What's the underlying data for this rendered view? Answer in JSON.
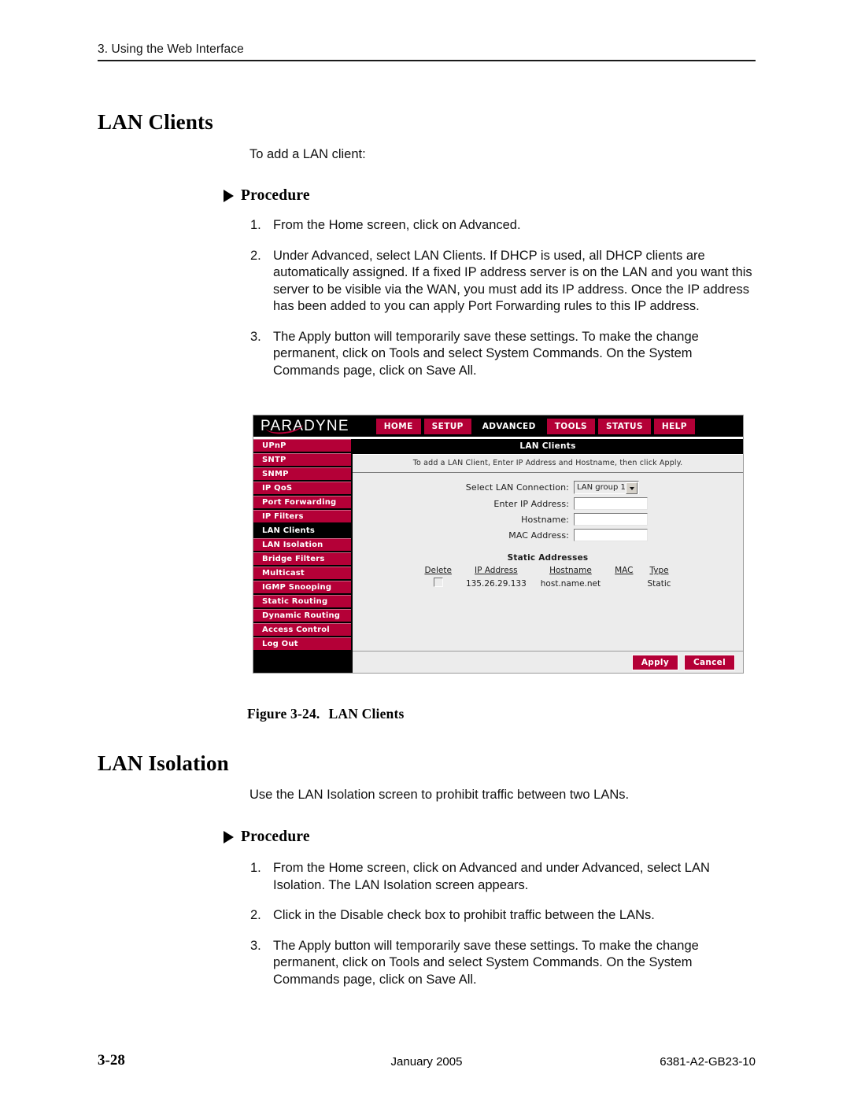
{
  "running_head": "3. Using the Web Interface",
  "sections": [
    {
      "heading": "LAN Clients",
      "intro": "To add a LAN client:",
      "procedure_label": "Procedure",
      "steps": [
        {
          "num": "1.",
          "text": "From the Home screen, click on Advanced."
        },
        {
          "num": "2.",
          "text": "Under Advanced, select LAN Clients. If DHCP is used, all DHCP clients are automatically assigned. If a fixed IP address server is on the LAN and you want this server to be visible via the WAN, you must add its IP address. Once the IP address has been added to you can apply Port Forwarding rules to this IP address."
        },
        {
          "num": "3.",
          "text": "The Apply button will temporarily save these settings. To make the change permanent, click on Tools and select System Commands. On the System Commands page, click on Save All."
        }
      ]
    },
    {
      "heading": "LAN Isolation",
      "intro": "Use the LAN Isolation screen to prohibit traffic between two LANs.",
      "procedure_label": "Procedure",
      "steps": [
        {
          "num": "1.",
          "text": "From the Home screen, click on Advanced and under Advanced, select LAN Isolation. The LAN Isolation screen appears."
        },
        {
          "num": "2.",
          "text": "Click in the Disable check box to prohibit traffic between the LANs."
        },
        {
          "num": "3.",
          "text": "The Apply button will temporarily save these settings. To make the change permanent, click on Tools and select System Commands. On the System Commands page, click on Save All."
        }
      ]
    }
  ],
  "figure": {
    "caption_number": "Figure 3-24.",
    "caption_title": "LAN Clients",
    "brand": "PARADYNE",
    "colors": {
      "accent": "#b40037",
      "active": "#000000"
    },
    "nav": [
      {
        "label": "HOME",
        "active": false
      },
      {
        "label": "SETUP",
        "active": false
      },
      {
        "label": "ADVANCED",
        "active": true
      },
      {
        "label": "TOOLS",
        "active": false
      },
      {
        "label": "STATUS",
        "active": false
      },
      {
        "label": "HELP",
        "active": false
      }
    ],
    "sidebar": [
      {
        "label": "UPnP",
        "active": false
      },
      {
        "label": "SNTP",
        "active": false
      },
      {
        "label": "SNMP",
        "active": false
      },
      {
        "label": "IP QoS",
        "active": false
      },
      {
        "label": "Port Forwarding",
        "active": false
      },
      {
        "label": "IP Filters",
        "active": false
      },
      {
        "label": "LAN Clients",
        "active": true
      },
      {
        "label": "LAN Isolation",
        "active": false
      },
      {
        "label": "Bridge Filters",
        "active": false
      },
      {
        "label": "Multicast",
        "active": false
      },
      {
        "label": "IGMP Snooping",
        "active": false
      },
      {
        "label": "Static Routing",
        "active": false
      },
      {
        "label": "Dynamic Routing",
        "active": false
      },
      {
        "label": "Access Control",
        "active": false
      },
      {
        "label": "Log Out",
        "active": false
      }
    ],
    "panel": {
      "title": "LAN Clients",
      "subtitle": "To add a LAN Client, Enter IP Address and Hostname, then click Apply.",
      "fields": [
        {
          "label": "Select LAN Connection:",
          "type": "select",
          "value": "LAN group 1"
        },
        {
          "label": "Enter IP Address:",
          "type": "text",
          "value": ""
        },
        {
          "label": "Hostname:",
          "type": "text",
          "value": ""
        },
        {
          "label": "MAC Address:",
          "type": "text",
          "value": ""
        }
      ],
      "static_addresses": {
        "title": "Static Addresses",
        "columns": [
          "Delete",
          "IP Address",
          "Hostname",
          "MAC",
          "Type"
        ],
        "rows": [
          {
            "delete": "",
            "ip": "135.26.29.133",
            "hostname": "host.name.net",
            "mac": "",
            "type": "Static"
          }
        ]
      },
      "buttons": [
        {
          "label": "Apply"
        },
        {
          "label": "Cancel"
        }
      ]
    }
  },
  "footer": {
    "page": "3-28",
    "date": "January 2005",
    "doc_number": "6381-A2-GB23-10"
  }
}
